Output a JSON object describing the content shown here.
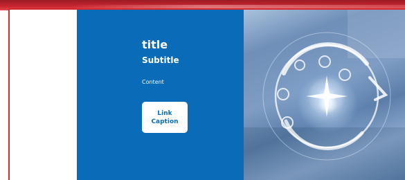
{
  "hero": {
    "title": "title",
    "subtitle": "Subtitle",
    "content": "Content",
    "link_caption": "Link\nCaption"
  },
  "colors": {
    "frame_red": "#d62a2f",
    "panel_blue": "#0a6cb8",
    "button_bg": "#ffffff",
    "button_text": "#0a6cb8"
  },
  "icons": {
    "image": "tech-circuit-image"
  }
}
